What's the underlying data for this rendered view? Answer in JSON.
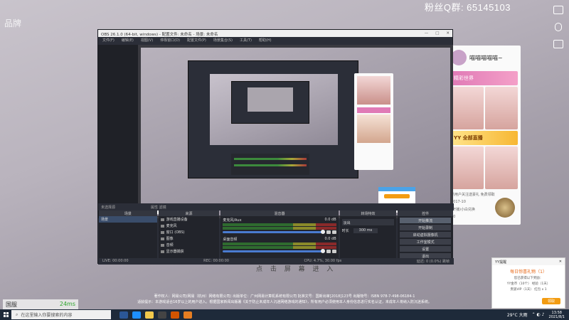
{
  "overlay": {
    "fans_label": "粉丝Q群:",
    "fans_number": "65145103",
    "top_left_tag": "品牌"
  },
  "widget": {
    "name": "喵喵喵喵喵~",
    "banner": "精彩世界",
    "ad": "YY 全部直播",
    "line1": "新用户关注送豪礼 免费领取",
    "line2": "2017-10",
    "line3": "(开播)小白兑换",
    "line4": "10"
  },
  "obs": {
    "title": "OBS 26.1.0 (64-bit, windows) - 配置文件: 未命名 - 场景: 未命名",
    "window_controls": [
      "—",
      "□",
      "✕"
    ],
    "menu": [
      "文件(F)",
      "编辑(E)",
      "视图(V)",
      "停靠窗口(D)",
      "配置文件(P)",
      "场景集合(S)",
      "工具(T)",
      "帮助(H)"
    ],
    "ctrlbar_left": "未选择源",
    "ctrlbar_mid": "属性  滤镜",
    "docks": {
      "scenes": {
        "header": "场景",
        "items": [
          "场景"
        ]
      },
      "sources": {
        "header": "来源",
        "items": [
          "游戏直播设备",
          "麦克风",
          "窗口 (OBS)",
          "图像",
          "音频",
          "显示器捕获"
        ]
      },
      "mixer": {
        "header": "混音器",
        "channels": [
          {
            "name": "麦克风/Aux",
            "db": "0.0 dB"
          },
          {
            "name": "桌面音频",
            "db": "0.0 dB"
          }
        ]
      },
      "transitions": {
        "header": "转场特效",
        "selected": "淡出",
        "duration_label": "时长",
        "duration_value": "300 ms"
      },
      "controls": {
        "header": "控件",
        "buttons": [
          "开始推流",
          "开始录制",
          "启动虚拟摄像机",
          "工作室模式",
          "设置",
          "退出"
        ]
      },
      "footer_symbols": "+ — ∧ ∨"
    },
    "status": {
      "live": "LIVE: 00:00:00",
      "rec": "REC: 00:00:00",
      "cpu": "CPU: 4.7%, 30.00 fps",
      "dropped": "延迟: 0 (0.0%) 跳帧"
    }
  },
  "stream": {
    "cta": "点 击 屏 幕 进 入",
    "copyright1": "著作权人：网易公司(网易（杭州）网络有限公司) 出版单位：广州网易计算机系统有限公司 批准文号：国新出审[2018]123号 出版物号：ISBN 978-7-498-06184-1",
    "copyright2": "适龄提示：本游戏适合16岁以上的用户进入。根据国家新闻出版署《关于防止未成年人沉迷网络游戏的通知》，所有用户必须使用本人身份信息进行实名认证，未成年人将纳入防沉迷系统。"
  },
  "netbox": {
    "label": "国服",
    "ping": "24ms"
  },
  "yy_popup": {
    "title": "YY提醒",
    "heading": "每日惊喜礼物（1）",
    "line1": "您已获得以下奖励：",
    "line2": "YY金币（10个）  经验（1天）",
    "line3": "贵族VIP（1天）  红包 x 1",
    "button": "领取"
  },
  "taskbar": {
    "search_placeholder": "在这里输入你要搜索的内容",
    "weather": "29°C 大雨",
    "time": "13:58",
    "date": "2021/8/1"
  }
}
